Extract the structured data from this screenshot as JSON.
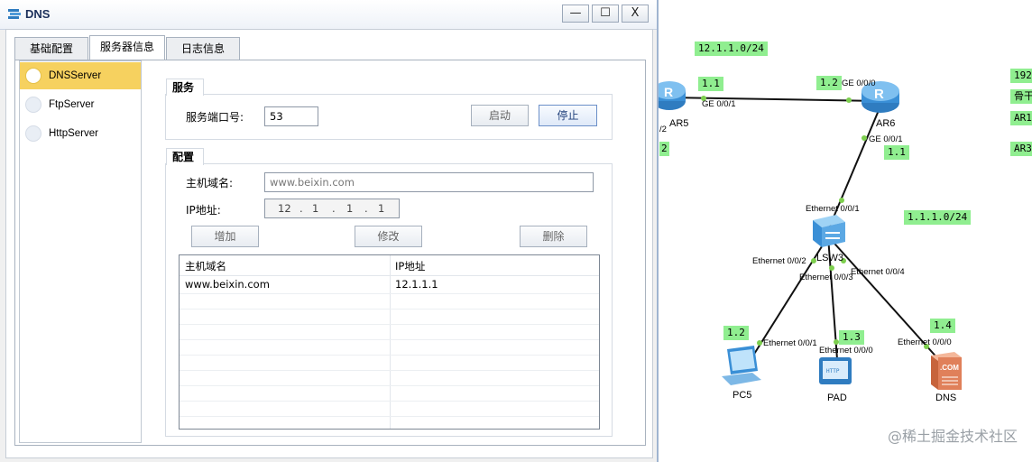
{
  "window": {
    "title": "DNS",
    "min_symbol": "—",
    "max_symbol": "☐",
    "close_symbol": "X"
  },
  "tabs": [
    {
      "label": "基础配置",
      "active": false
    },
    {
      "label": "服务器信息",
      "active": true
    },
    {
      "label": "日志信息",
      "active": false
    }
  ],
  "server_list": [
    {
      "label": "DNSServer",
      "selected": true
    },
    {
      "label": "FtpServer",
      "selected": false
    },
    {
      "label": "HttpServer",
      "selected": false
    }
  ],
  "service": {
    "group_title": "服务",
    "port_label": "服务端口号:",
    "port_value": "53",
    "start_label": "启动",
    "stop_label": "停止"
  },
  "config": {
    "group_title": "配置",
    "host_label": "主机域名:",
    "host_placeholder": "www.beixin.com",
    "ip_label": "IP地址:",
    "ip_octets": [
      "12",
      "1",
      "1",
      "1"
    ],
    "add_label": "增加",
    "modify_label": "修改",
    "delete_label": "删除",
    "table": {
      "columns": [
        "主机域名",
        "IP地址"
      ],
      "rows": [
        [
          "www.beixin.com",
          "12.1.1.1"
        ]
      ]
    }
  },
  "topology": {
    "subnet_tags": [
      "12.1.1.0/24",
      "1.1.1.0/24",
      "192",
      "骨干",
      "AR1",
      "AR3"
    ],
    "addr_tags": [
      "1.1",
      "1.2",
      "1.1",
      "1.2",
      "1.3",
      "1.4",
      "2"
    ],
    "port_labels": [
      "GE 0/0/0",
      "GE 0/0/1",
      "GE 0/0/1",
      "Ethernet 0/0/1",
      "Ethernet 0/0/2",
      "Ethernet 0/0/3",
      "Ethernet 0/0/4",
      "Ethernet 0/0/1",
      "Ethernet 0/0/0",
      "Ethernet 0/0/0",
      "/2"
    ],
    "devices": [
      "AR5",
      "AR6",
      "LSW3",
      "PC5",
      "PAD",
      "DNS"
    ],
    "watermark": "@稀土掘金技术社区"
  },
  "colors": {
    "link_label_bg": "#90ee90",
    "selected_item": "#f6d15f",
    "router_blue": "#3a8fd6"
  }
}
